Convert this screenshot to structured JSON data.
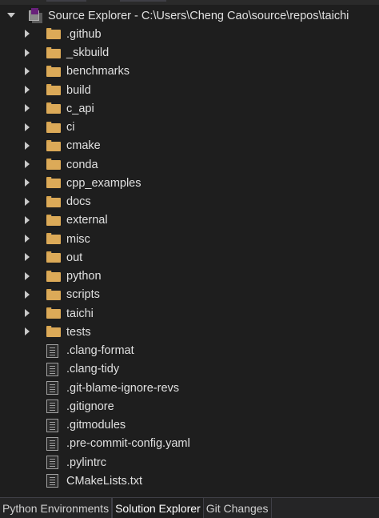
{
  "solution": {
    "label": "Source Explorer - C:\\Users\\Cheng Cao\\source\\repos\\taichi",
    "icon": "solution-icon"
  },
  "folders": [
    {
      "label": ".github"
    },
    {
      "label": "_skbuild"
    },
    {
      "label": "benchmarks"
    },
    {
      "label": "build"
    },
    {
      "label": "c_api"
    },
    {
      "label": "ci"
    },
    {
      "label": "cmake"
    },
    {
      "label": "conda"
    },
    {
      "label": "cpp_examples"
    },
    {
      "label": "docs"
    },
    {
      "label": "external"
    },
    {
      "label": "misc"
    },
    {
      "label": "out"
    },
    {
      "label": "python"
    },
    {
      "label": "scripts"
    },
    {
      "label": "taichi"
    },
    {
      "label": "tests"
    }
  ],
  "files": [
    {
      "label": ".clang-format"
    },
    {
      "label": ".clang-tidy"
    },
    {
      "label": ".git-blame-ignore-revs"
    },
    {
      "label": ".gitignore"
    },
    {
      "label": ".gitmodules"
    },
    {
      "label": ".pre-commit-config.yaml"
    },
    {
      "label": ".pylintrc"
    },
    {
      "label": "CMakeLists.txt"
    }
  ],
  "bottom_tabs": [
    {
      "label": "Python Environments",
      "active": false
    },
    {
      "label": "Solution Explorer",
      "active": true
    },
    {
      "label": "Git Changes",
      "active": false
    }
  ],
  "colors": {
    "background": "#1e1e1e",
    "folder": "#dcaa58",
    "text": "#e0e0e0"
  }
}
